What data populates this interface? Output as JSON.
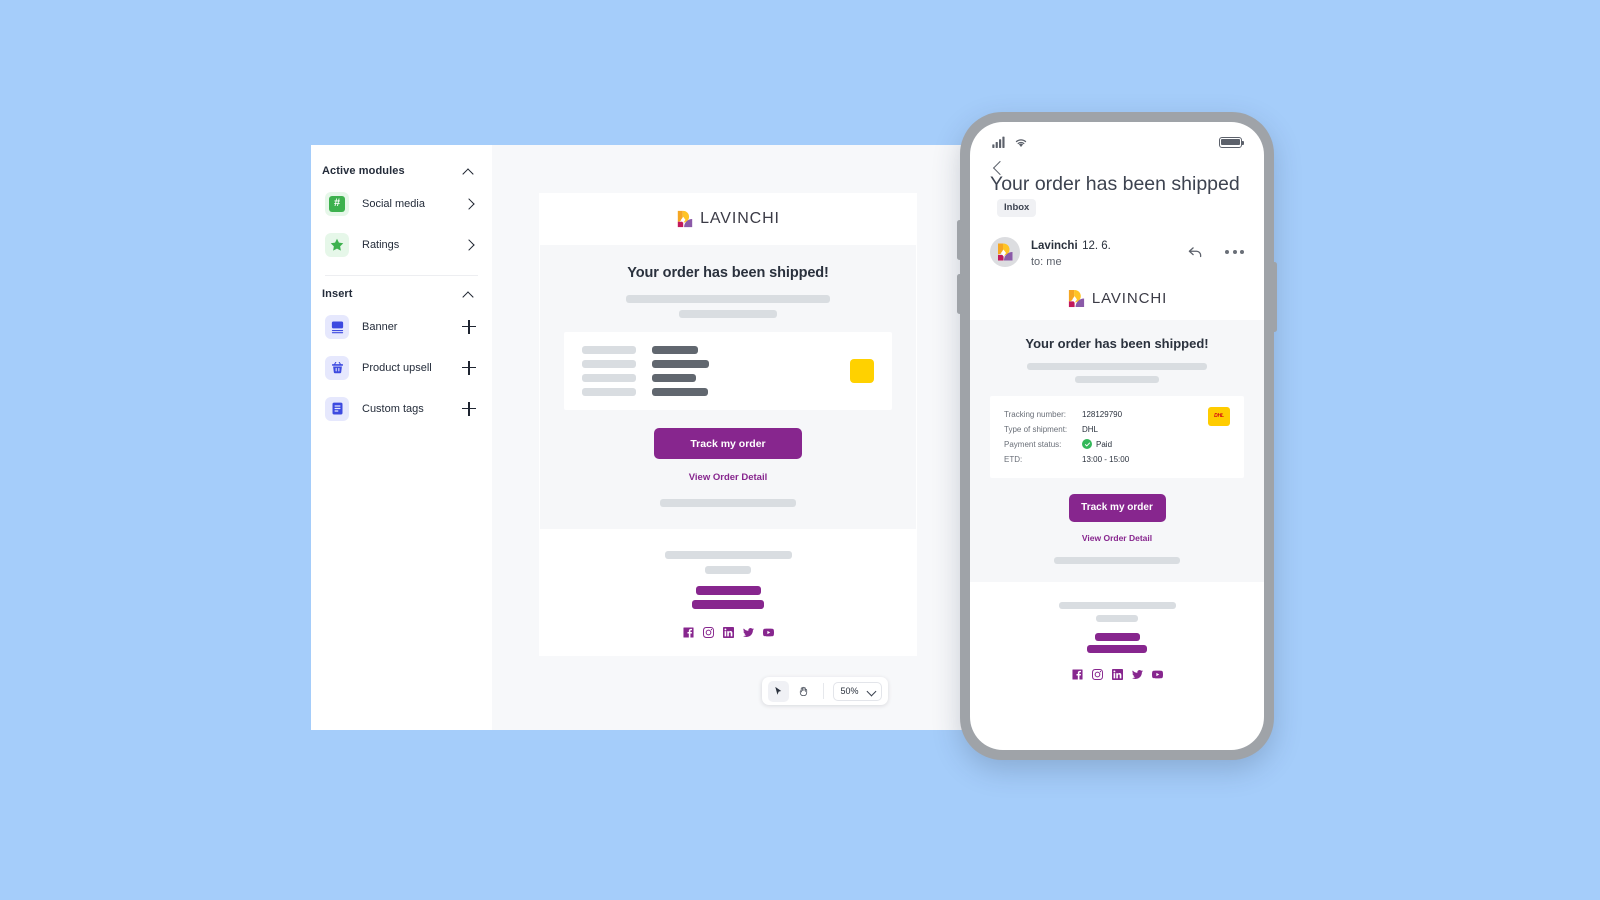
{
  "sidebar": {
    "sections": [
      {
        "title": "Active modules",
        "collapse_icon": "chevron-up-icon",
        "items": [
          {
            "label": "Social media",
            "icon": "hashtag-icon",
            "action_icon": "chevron-right-icon"
          },
          {
            "label": "Ratings",
            "icon": "star-icon",
            "action_icon": "chevron-right-icon"
          }
        ]
      },
      {
        "title": "Insert",
        "collapse_icon": "chevron-up-icon",
        "items": [
          {
            "label": "Banner",
            "icon": "banner-icon",
            "action_icon": "plus-icon"
          },
          {
            "label": "Product upsell",
            "icon": "basket-icon",
            "action_icon": "plus-icon"
          },
          {
            "label": "Custom tags",
            "icon": "document-icon",
            "action_icon": "plus-icon"
          }
        ]
      }
    ]
  },
  "toolbar": {
    "cursor_tool": "cursor-icon",
    "hand_tool": "hand-icon",
    "zoom_value": "50%",
    "zoom_caret": "chevron-down-icon"
  },
  "email": {
    "brand": "LAVINCHI",
    "heading": "Your order has been shipped!",
    "cta_label": "Track my order",
    "link_label": "View Order Detail",
    "social": [
      "facebook-icon",
      "instagram-icon",
      "linkedin-icon",
      "twitter-icon",
      "youtube-icon"
    ]
  },
  "phone": {
    "status": {
      "signal": "signal-icon",
      "wifi": "wifi-icon",
      "battery": "battery-icon"
    },
    "back_icon": "chevron-left-icon",
    "subject": "Your order has been shipped",
    "label_badge": "Inbox",
    "sender_name": "Lavinchi",
    "sender_date": "12. 6.",
    "recipient": "to: me",
    "reply_icon": "reply-icon",
    "more_icon": "more-options-icon",
    "brand": "LAVINCHI",
    "heading": "Your order has been shipped!",
    "details": [
      {
        "label": "Tracking number:",
        "value": "128129790"
      },
      {
        "label": "Type of shipment:",
        "value": "DHL"
      },
      {
        "label": "Payment status:",
        "value": "Paid",
        "status_icon": "check-circle-icon"
      },
      {
        "label": "ETD:",
        "value": "13:00 - 15:00"
      }
    ],
    "carrier_badge": "DHL",
    "cta_label": "Track my order",
    "link_label": "View Order Detail",
    "social": [
      "facebook-icon",
      "instagram-icon",
      "linkedin-icon",
      "twitter-icon",
      "youtube-icon"
    ]
  },
  "colors": {
    "background": "#a5cdfa",
    "brand_purple": "#87268e",
    "accent_yellow": "#ffd100",
    "icon_indigo": "#3d4ae0",
    "icon_green": "#3db14e",
    "status_green": "#34b85a",
    "dhl_red": "#d40511"
  }
}
